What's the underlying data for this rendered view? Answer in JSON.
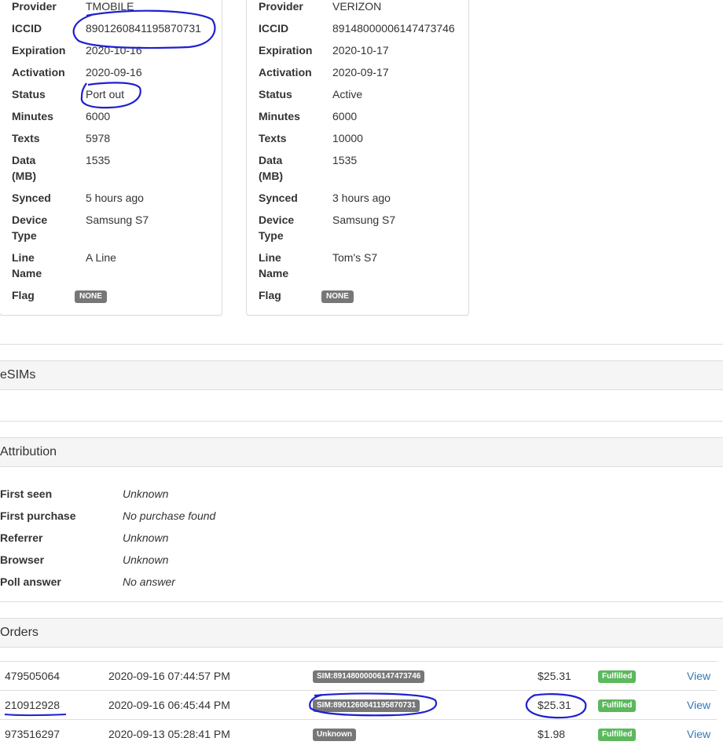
{
  "cards": [
    {
      "rows": [
        {
          "key": "Provider",
          "value": "TMOBILE"
        },
        {
          "key": "ICCID",
          "value": "8901260841195870731",
          "link": true
        },
        {
          "key": "Expiration",
          "value": "2020-10-16"
        },
        {
          "key": "Activation",
          "value": "2020-09-16"
        },
        {
          "key": "Status",
          "value": "Port out"
        },
        {
          "key": "Minutes",
          "value": "6000"
        },
        {
          "key": "Texts",
          "value": "5978"
        },
        {
          "key": "Data (MB)",
          "value": "1535"
        },
        {
          "key": "Synced",
          "value": "5 hours ago"
        },
        {
          "key": "Device Type",
          "value": "Samsung S7"
        },
        {
          "key": "Line Name",
          "value": "A Line"
        },
        {
          "key": "Flag",
          "value": "NONE"
        }
      ]
    },
    {
      "rows": [
        {
          "key": "Provider",
          "value": "VERIZON"
        },
        {
          "key": "ICCID",
          "value": "89148000006147473746",
          "link": true
        },
        {
          "key": "Expiration",
          "value": "2020-10-17"
        },
        {
          "key": "Activation",
          "value": "2020-09-17"
        },
        {
          "key": "Status",
          "value": "Active"
        },
        {
          "key": "Minutes",
          "value": "6000"
        },
        {
          "key": "Texts",
          "value": "10000"
        },
        {
          "key": "Data (MB)",
          "value": "1535"
        },
        {
          "key": "Synced",
          "value": "3 hours ago"
        },
        {
          "key": "Device Type",
          "value": "Samsung S7"
        },
        {
          "key": "Line Name",
          "value": "Tom's S7"
        },
        {
          "key": "Flag",
          "value": "NONE"
        }
      ]
    }
  ],
  "sections": {
    "esims": "eSIMs",
    "attribution": "Attribution",
    "orders": "Orders"
  },
  "attribution": [
    {
      "key": "First seen",
      "value": "Unknown"
    },
    {
      "key": "First purchase",
      "value": "No purchase found"
    },
    {
      "key": "Referrer",
      "value": "Unknown"
    },
    {
      "key": "Browser",
      "value": "Unknown"
    },
    {
      "key": "Poll answer",
      "value": "No answer"
    }
  ],
  "orders": [
    {
      "id": "479505064",
      "date": "2020-09-16 07:44:57 PM",
      "sim": "SIM:89148000006147473746",
      "price": "$25.31",
      "status": "Fulfilled",
      "action": "View"
    },
    {
      "id": "210912928",
      "date": "2020-09-16 06:45:44 PM",
      "sim": "SIM:8901260841195870731",
      "price": "$25.31",
      "status": "Fulfilled",
      "action": "View"
    },
    {
      "id": "973516297",
      "date": "2020-09-13 05:28:41 PM",
      "sim": "Unknown",
      "price": "$1.98",
      "status": "Fulfilled",
      "action": "View"
    }
  ]
}
